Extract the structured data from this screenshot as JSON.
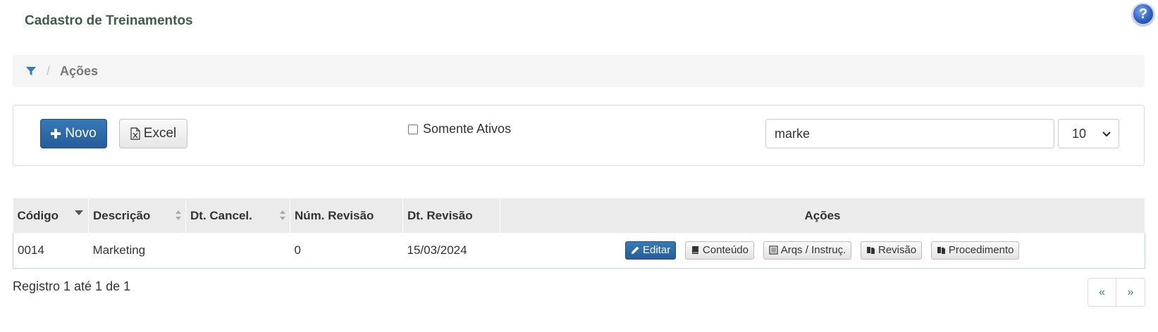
{
  "header": {
    "title": "Cadastro de Treinamentos",
    "help_label": "?"
  },
  "breadcrumb": {
    "separator": "/",
    "current": "Ações"
  },
  "toolbar": {
    "new_label": "Novo",
    "excel_label": "Excel",
    "only_active_label": "Somente Ativos",
    "only_active_checked": false,
    "search_value": "marke",
    "page_size": "10"
  },
  "table": {
    "columns": [
      "Código",
      "Descrição",
      "Dt. Cancel.",
      "Núm. Revisão",
      "Dt. Revisão",
      "Ações"
    ],
    "rows": [
      {
        "codigo": "0014",
        "descricao": "Marketing",
        "dt_cancel": "",
        "num_revisao": "0",
        "dt_revisao": "15/03/2024"
      }
    ],
    "row_actions": [
      "Editar",
      "Conteúdo",
      "Arqs / Instruç.",
      "Revisão",
      "Procedimento"
    ]
  },
  "footer": {
    "summary": "Registro 1 até 1 de 1",
    "prev_label": "«",
    "next_label": "»"
  },
  "colors": {
    "primary": "#2d6aa8",
    "title": "#3f5c48",
    "header_bg": "#ebebeb"
  }
}
